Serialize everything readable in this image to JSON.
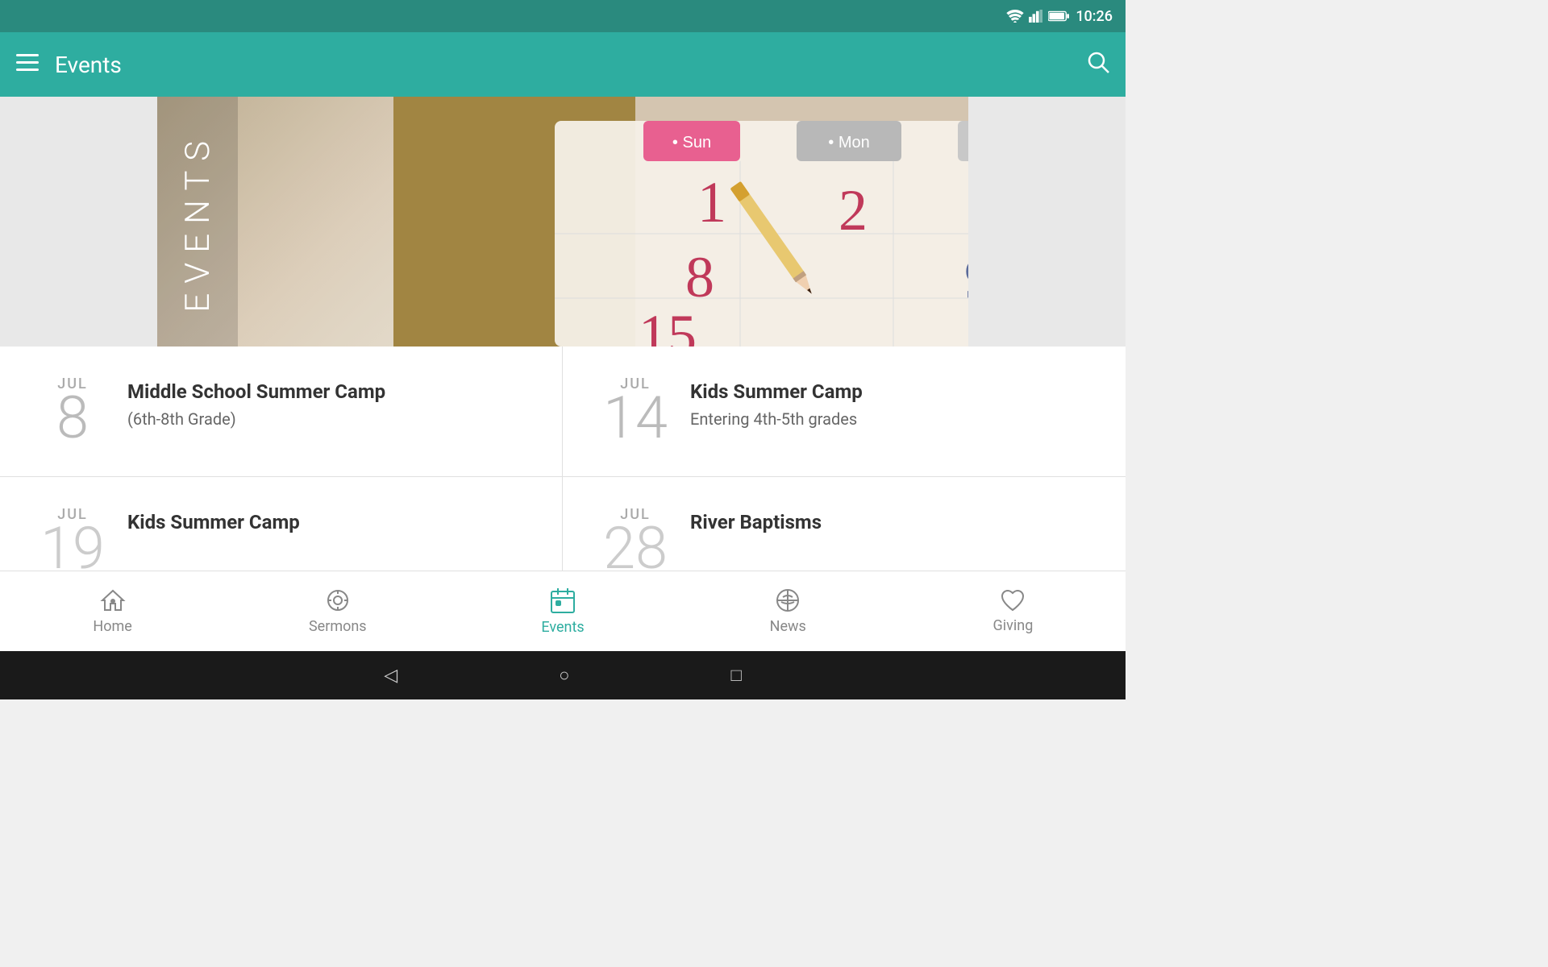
{
  "statusBar": {
    "time": "10:26",
    "wifiIcon": "📶",
    "signalIcon": "📶",
    "batteryIcon": "🔋"
  },
  "appBar": {
    "title": "Events",
    "menuIcon": "≡",
    "searchIcon": "🔍"
  },
  "hero": {
    "verticalText": "EVENTS"
  },
  "events": [
    {
      "month": "JUL",
      "day": "8",
      "title": "Middle School Summer Camp",
      "subtitle": "(6th-8th Grade)"
    },
    {
      "month": "JUL",
      "day": "14",
      "title": "Kids Summer Camp",
      "subtitle": "Entering 4th-5th grades"
    },
    {
      "month": "JUL",
      "day": "19",
      "title": "Kids Summer Camp",
      "subtitle": ""
    },
    {
      "month": "JUL",
      "day": "28",
      "title": "River Baptisms",
      "subtitle": ""
    }
  ],
  "bottomNav": [
    {
      "id": "home",
      "label": "Home",
      "icon": "📍",
      "active": false
    },
    {
      "id": "sermons",
      "label": "Sermons",
      "icon": "🎧",
      "active": false
    },
    {
      "id": "events",
      "label": "Events",
      "icon": "📅",
      "active": true
    },
    {
      "id": "news",
      "label": "News",
      "icon": "💬",
      "active": false
    },
    {
      "id": "giving",
      "label": "Giving",
      "icon": "♡",
      "active": false
    }
  ],
  "androidNav": {
    "backIcon": "◁",
    "homeIcon": "○",
    "recentIcon": "□"
  }
}
